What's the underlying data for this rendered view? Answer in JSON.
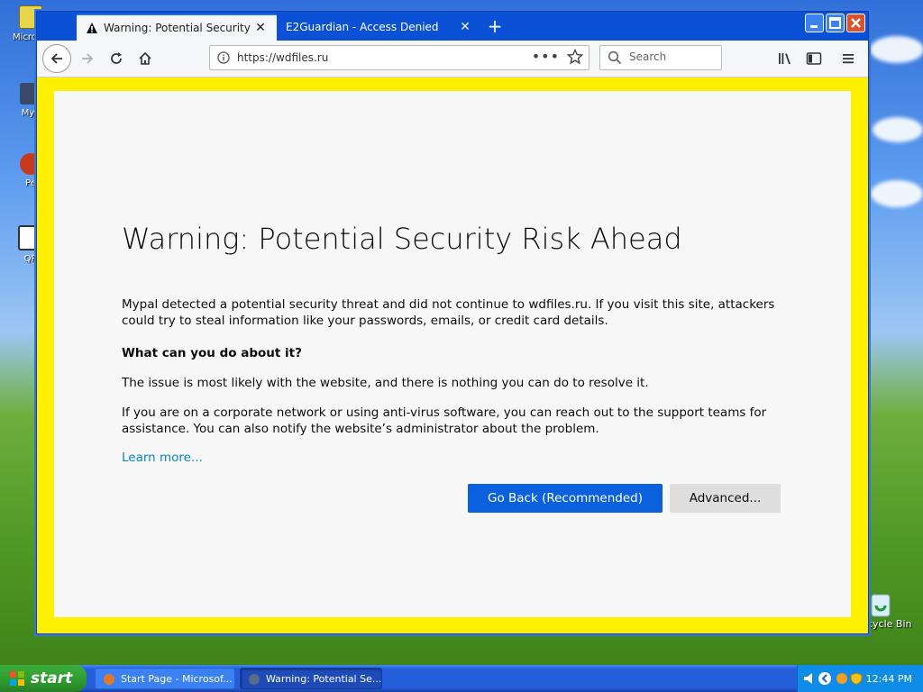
{
  "desktop": {
    "icons": [
      {
        "label": "Micro Outl"
      },
      {
        "label": "MyP"
      },
      {
        "label": "Pe"
      },
      {
        "label": "QR"
      }
    ],
    "recycle_bin_label": "cycle Bin"
  },
  "browser": {
    "tabs": [
      {
        "label": "Warning: Potential Security Risk A",
        "active": true,
        "icon": "warning-icon"
      },
      {
        "label": "E2Guardian - Access Denied",
        "active": false
      }
    ],
    "new_tab_label": "+",
    "url": "https://wdfiles.ru",
    "search_placeholder": "Search"
  },
  "error_page": {
    "title": "Warning: Potential Security Risk Ahead",
    "intro": "Mypal detected a potential security threat and did not continue to wdfiles.ru. If you visit this site, attackers could try to steal information like your passwords, emails, or credit card details.",
    "what_heading": "What can you do about it?",
    "issue_text": "The issue is most likely with the website, and there is nothing you can do to resolve it.",
    "corporate_text": "If you are on a corporate network or using anti-virus software, you can reach out to the support teams for assistance. You can also notify the website’s administrator about the problem.",
    "learn_more": "Learn more...",
    "go_back_label": "Go Back (Recommended)",
    "advanced_label": "Advanced..."
  },
  "taskbar": {
    "start_label": "start",
    "tasks": [
      {
        "label": "Start Page - Microsof..."
      },
      {
        "label": "Warning: Potential Se..."
      }
    ],
    "clock": "12:44 PM"
  },
  "colors": {
    "page_border": "#ffef00",
    "primary_button": "#0a60dd",
    "link": "#0a84c2",
    "tab_bar": "#0a51d6"
  }
}
